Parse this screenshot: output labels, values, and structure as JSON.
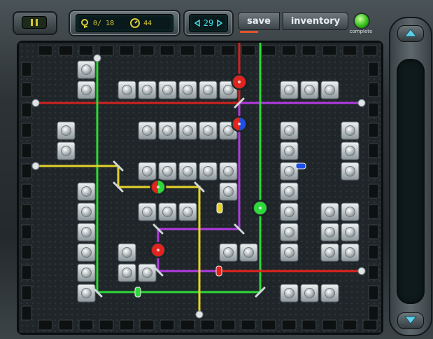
{
  "hud": {
    "moves_used": "0/",
    "moves_total": "18",
    "time_left": "44",
    "level_number": "29",
    "save_label": "save",
    "inventory_label": "inventory",
    "complete_label": "complete"
  },
  "colors": {
    "red": "#e2241e",
    "green": "#2fd83a",
    "purple": "#b23be0",
    "yellow": "#e3d32a",
    "blue": "#1f4ee8",
    "hud_text": "#d7c93a",
    "level_text": "#3fe0e6"
  },
  "icons": [
    "pause-icon",
    "key-icon",
    "clock-icon",
    "left-arrow-icon",
    "right-arrow-icon",
    "up-arrow-icon",
    "down-arrow-icon",
    "emitter-icon",
    "receiver-icon",
    "mirror-icon",
    "filter-icon"
  ]
}
